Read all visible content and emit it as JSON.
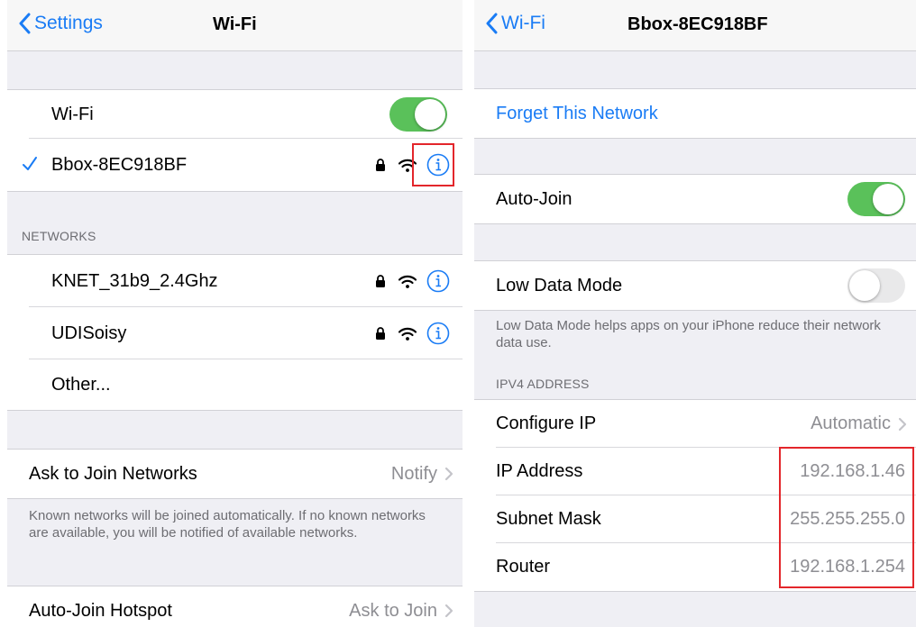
{
  "left": {
    "back_label": "Settings",
    "title": "Wi-Fi",
    "wifi_label": "Wi-Fi",
    "wifi_on": true,
    "connected_network": "Bbox-8EC918BF",
    "networks_header": "NETWORKS",
    "networks": [
      {
        "name": "KNET_31b9_2.4Ghz"
      },
      {
        "name": "UDISoisy"
      }
    ],
    "other_label": "Other...",
    "ask_join_label": "Ask to Join Networks",
    "ask_join_value": "Notify",
    "ask_join_footnote": "Known networks will be joined automatically. If no known networks are available, you will be notified of available networks.",
    "hotspot_label": "Auto-Join Hotspot",
    "hotspot_value": "Ask to Join"
  },
  "right": {
    "back_label": "Wi-Fi",
    "title": "Bbox-8EC918BF",
    "forget_label": "Forget This Network",
    "auto_join_label": "Auto-Join",
    "auto_join_on": true,
    "low_data_label": "Low Data Mode",
    "low_data_on": false,
    "low_data_footnote": "Low Data Mode helps apps on your iPhone reduce their network data use.",
    "ipv4_header": "IPV4 ADDRESS",
    "configure_ip_label": "Configure IP",
    "configure_ip_value": "Automatic",
    "ip_label": "IP Address",
    "ip_value": "192.168.1.46",
    "subnet_label": "Subnet Mask",
    "subnet_value": "255.255.255.0",
    "router_label": "Router",
    "router_value": "192.168.1.254"
  },
  "colors": {
    "accent": "#1a7cf5",
    "switch_on": "#5ac15a",
    "highlight": "#e3262b",
    "background": "#efeff4"
  },
  "icons": [
    "chevron-left-icon",
    "checkmark-icon",
    "lock-icon",
    "wifi-icon",
    "info-icon",
    "chevron-right-icon"
  ]
}
